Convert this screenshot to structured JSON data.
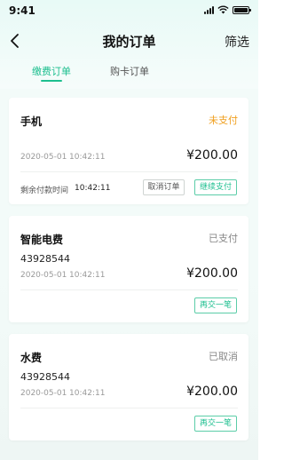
{
  "status_bar": {
    "time": "9:41"
  },
  "nav": {
    "title": "我的订单",
    "filter_label": "筛选"
  },
  "tabs": [
    {
      "label": "缴费订单",
      "active": true
    },
    {
      "label": "购卡订单",
      "active": false
    }
  ],
  "orders": [
    {
      "title": "手机",
      "status": "未支付",
      "status_color": "#f0a020",
      "date": "2020-05-01",
      "time": "10:42:11",
      "amount": "¥200.00",
      "remaining_label": "剩余付款时间",
      "remaining_time": "10:42:11",
      "cancel_label": "取消订单",
      "continue_label": "继续支付"
    },
    {
      "title": "智能电费",
      "status": "已支付",
      "status_color": "#888888",
      "number": "43928544",
      "date": "2020-05-01",
      "time": "10:42:11",
      "amount": "¥200.00",
      "again_label": "再交一笔"
    },
    {
      "title": "水费",
      "status": "已取消",
      "status_color": "#888888",
      "number": "43928544",
      "date": "2020-05-01",
      "time": "10:42:11",
      "amount": "¥200.00",
      "again_label": "再交一笔"
    }
  ],
  "colors": {
    "accent": "#1dbf8f",
    "pending": "#f0a020",
    "muted": "#888888"
  },
  "icons": {
    "back": "chevron-left-icon",
    "signal": "signal-icon",
    "wifi": "wifi-icon",
    "battery": "battery-icon"
  }
}
